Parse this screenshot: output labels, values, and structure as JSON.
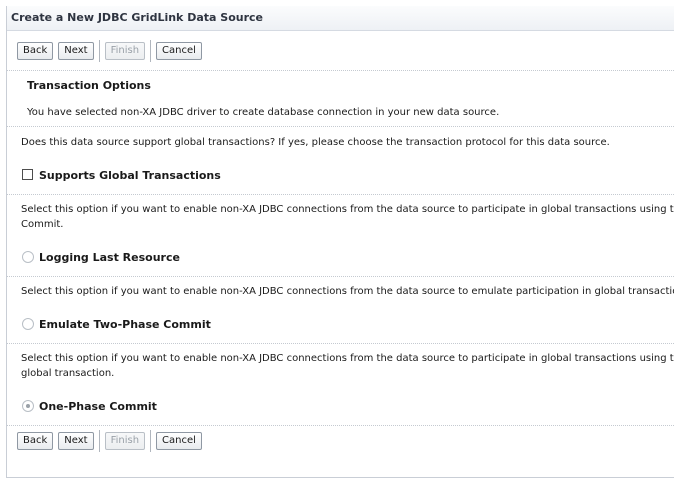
{
  "title": "Create a New JDBC GridLink Data Source",
  "buttons": {
    "back": "Back",
    "next": "Next",
    "finish": "Finish",
    "cancel": "Cancel"
  },
  "section": {
    "heading": "Transaction Options",
    "intro": "You have selected non-XA JDBC driver to create database connection in your new data source.",
    "question": "Does this data source support global transactions? If yes, please choose the transaction protocol for this data source."
  },
  "options": {
    "supports_global": {
      "label": "Supports Global Transactions",
      "checked": false
    },
    "llr": {
      "description_1": "Select this option if you want to enable non-XA JDBC connections from the data source to participate in global transactions using the Lo",
      "description_2": "Commit.",
      "label": "Logging Last Resource"
    },
    "emulate": {
      "description_1": "Select this option if you want to enable non-XA JDBC connections from the data source to emulate participation in global transactions usi",
      "label": "Emulate Two-Phase Commit"
    },
    "one_phase": {
      "description_1": "Select this option if you want to enable non-XA JDBC connections from the data source to participate in global transactions using the one",
      "description_2": "global transaction.",
      "label": "One-Phase Commit",
      "selected": true
    }
  }
}
